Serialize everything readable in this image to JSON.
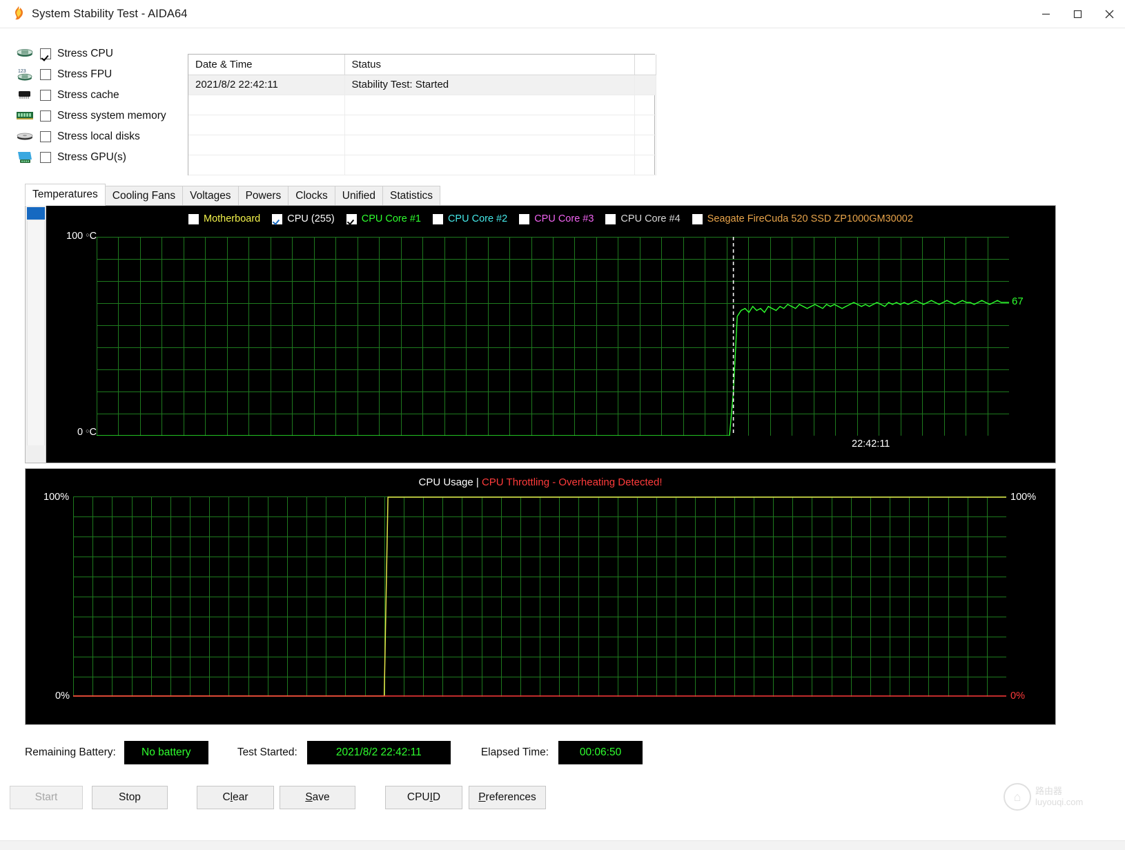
{
  "window": {
    "title": "System Stability Test - AIDA64",
    "icon": "flame-icon",
    "minimize": "−",
    "maximize": "□",
    "close": "✕"
  },
  "stress_options": [
    {
      "label": "Stress CPU",
      "checked": true,
      "icon": "cpu-chip-icon"
    },
    {
      "label": "Stress FPU",
      "checked": false,
      "icon": "fpu-chip-icon"
    },
    {
      "label": "Stress cache",
      "checked": false,
      "icon": "cache-chip-icon"
    },
    {
      "label": "Stress system memory",
      "checked": false,
      "icon": "memory-module-icon"
    },
    {
      "label": "Stress local disks",
      "checked": false,
      "icon": "hard-disk-icon"
    },
    {
      "label": "Stress GPU(s)",
      "checked": false,
      "icon": "gpu-display-icon"
    }
  ],
  "log": {
    "columns": [
      "Date & Time",
      "Status"
    ],
    "rows": [
      {
        "datetime": "2021/8/2 22:42:11",
        "status": "Stability Test: Started"
      },
      {
        "datetime": "",
        "status": ""
      },
      {
        "datetime": "",
        "status": ""
      },
      {
        "datetime": "",
        "status": ""
      },
      {
        "datetime": "",
        "status": ""
      }
    ]
  },
  "tabs": [
    {
      "label": "Temperatures",
      "active": true
    },
    {
      "label": "Cooling Fans",
      "active": false
    },
    {
      "label": "Voltages",
      "active": false
    },
    {
      "label": "Powers",
      "active": false
    },
    {
      "label": "Clocks",
      "active": false
    },
    {
      "label": "Unified",
      "active": false
    },
    {
      "label": "Statistics",
      "active": false
    }
  ],
  "temperature_chart": {
    "legend": [
      {
        "label": "Motherboard",
        "color": "#f2f24a",
        "checked": false
      },
      {
        "label": "CPU (255)",
        "color": "#ffffff",
        "checked": true
      },
      {
        "label": "CPU Core #1",
        "color": "#2eff2e",
        "checked": true
      },
      {
        "label": "CPU Core #2",
        "color": "#45e8e8",
        "checked": false
      },
      {
        "label": "CPU Core #3",
        "color": "#f062f0",
        "checked": false
      },
      {
        "label": "CPU Core #4",
        "color": "#d9d9d9",
        "checked": false
      },
      {
        "label": "Seagate FireCuda 520 SSD ZP1000GM30002",
        "color": "#e8a44a",
        "checked": false
      }
    ],
    "y_top_label": "100",
    "y_top_unit": "C",
    "y_bottom_label": "0",
    "y_bottom_unit": "C",
    "current_value": "67",
    "cursor_timestamp": "22:42:11",
    "grid_color": "#1e7a1e",
    "trace_color": "#2eff2e"
  },
  "usage_chart": {
    "title": "CPU Usage",
    "separator": "|",
    "warning": "CPU Throttling - Overheating Detected!",
    "warning_color": "#ff3b3b",
    "y_top_left": "100%",
    "y_bottom_left": "0%",
    "y_top_right": "100%",
    "y_bottom_right": "0%",
    "usage_trace_color": "#e8e84a",
    "throttle_trace_color": "#ff3b3b",
    "grid_color": "#1e7a1e"
  },
  "status": {
    "battery_label": "Remaining Battery:",
    "battery_value": "No battery",
    "started_label": "Test Started:",
    "started_value": "2021/8/2 22:42:11",
    "elapsed_label": "Elapsed Time:",
    "elapsed_value": "00:06:50"
  },
  "buttons": [
    {
      "label": "Start",
      "disabled": true,
      "accel": ""
    },
    {
      "label": "Stop",
      "disabled": false,
      "accel": ""
    },
    {
      "label": "Clear",
      "disabled": false,
      "accel": "l"
    },
    {
      "label": "Save",
      "disabled": false,
      "accel": "S"
    },
    {
      "label": "CPUID",
      "disabled": false,
      "accel": "I"
    },
    {
      "label": "Preferences",
      "disabled": false,
      "accel": "P"
    }
  ],
  "watermark": {
    "line1": "路由器",
    "line2": "luyouqi.com"
  },
  "chart_data": [
    {
      "type": "line",
      "title": "Temperatures",
      "xlabel": "",
      "ylabel": "C",
      "ylim": [
        0,
        100
      ],
      "grid": true,
      "legend_position": "top",
      "x_tick_labels": [
        "22:42:11"
      ],
      "series": [
        {
          "name": "CPU Core #1",
          "color": "#2eff2e",
          "current": 67,
          "values": [
            0,
            0,
            0,
            0,
            0,
            0,
            0,
            0,
            0,
            0,
            0,
            0,
            0,
            0,
            0,
            0,
            0,
            0,
            0,
            0,
            0,
            0,
            0,
            0,
            0,
            0,
            0,
            0,
            0,
            0,
            0,
            0,
            0,
            0,
            0,
            0,
            0,
            0,
            0,
            0,
            0,
            0,
            0,
            0,
            0,
            0,
            0,
            0,
            0,
            0,
            0,
            0,
            0,
            0,
            0,
            0,
            0,
            0,
            0,
            0,
            0,
            0,
            0,
            0,
            0,
            0,
            0,
            0,
            0,
            0,
            0,
            0,
            0,
            0,
            0,
            0,
            0,
            0,
            0,
            0,
            0,
            0,
            0,
            0,
            0,
            0,
            0,
            0,
            0,
            0,
            0,
            0,
            0,
            0,
            0,
            0,
            0,
            0,
            0,
            0,
            0,
            0,
            0,
            0,
            0,
            0,
            0,
            0,
            0,
            0,
            0,
            0,
            0,
            0,
            0,
            0,
            0,
            0,
            0,
            0,
            0,
            0,
            0,
            0,
            0,
            0,
            0,
            0,
            0,
            0,
            0,
            0,
            0,
            0,
            0,
            0,
            0,
            0,
            0,
            0,
            0,
            0,
            0,
            0,
            0,
            0,
            0,
            0,
            0,
            0,
            0,
            0,
            0,
            0,
            0,
            0,
            0,
            0,
            0,
            0,
            0,
            0,
            0,
            0,
            22,
            60,
            63,
            64,
            62,
            65,
            63,
            64,
            62,
            65,
            64,
            63,
            65,
            64,
            66,
            65,
            64,
            66,
            65,
            64,
            65,
            66,
            65,
            64,
            66,
            65,
            66,
            65,
            64,
            65,
            66,
            67,
            66,
            65,
            66,
            65,
            66,
            67,
            66,
            65,
            67,
            66,
            67,
            66,
            67,
            66,
            67,
            68,
            67,
            66,
            67,
            68,
            67,
            66,
            67,
            68,
            67,
            66,
            67,
            68,
            67,
            67,
            66,
            67,
            68,
            67,
            66,
            67,
            68,
            67,
            67,
            67
          ]
        }
      ]
    },
    {
      "type": "line",
      "title": "CPU Usage",
      "xlabel": "",
      "ylabel": "%",
      "ylim": [
        0,
        100
      ],
      "grid": true,
      "series": [
        {
          "name": "CPU Usage",
          "color": "#e8e84a",
          "values": [
            0,
            0,
            0,
            0,
            0,
            0,
            0,
            0,
            0,
            0,
            0,
            0,
            0,
            0,
            0,
            0,
            0,
            0,
            0,
            0,
            0,
            0,
            0,
            0,
            0,
            0,
            0,
            0,
            0,
            0,
            0,
            0,
            0,
            0,
            0,
            0,
            0,
            0,
            0,
            0,
            0,
            0,
            0,
            0,
            0,
            0,
            0,
            0,
            0,
            0,
            0,
            0,
            0,
            0,
            0,
            0,
            0,
            0,
            0,
            0,
            0,
            0,
            0,
            0,
            0,
            0,
            0,
            0,
            0,
            0,
            0,
            0,
            0,
            0,
            0,
            0,
            0,
            0,
            0,
            0,
            0,
            0,
            0,
            0,
            100,
            100,
            100,
            100,
            100,
            100,
            100,
            100,
            100,
            100,
            100,
            100,
            100,
            100,
            100,
            100,
            100,
            100,
            100,
            100,
            100,
            100,
            100,
            100,
            100,
            100,
            100,
            100,
            100,
            100,
            100,
            100,
            100,
            100,
            100,
            100,
            100,
            100,
            100,
            100,
            100,
            100,
            100,
            100,
            100,
            100,
            100,
            100,
            100,
            100,
            100,
            100,
            100,
            100,
            100,
            100,
            100,
            100,
            100,
            100,
            100,
            100,
            100,
            100,
            100,
            100,
            100,
            100,
            100,
            100,
            100,
            100,
            100,
            100,
            100,
            100,
            100,
            100,
            100,
            100,
            100,
            100,
            100,
            100,
            100,
            100,
            100,
            100,
            100,
            100,
            100,
            100,
            100,
            100,
            100,
            100,
            100,
            100,
            100,
            100,
            100,
            100,
            100,
            100,
            100,
            100,
            100,
            100,
            100,
            100,
            100,
            100,
            100,
            100,
            100,
            100,
            100,
            100,
            100,
            100,
            100,
            100,
            100,
            100,
            100,
            100,
            100,
            100,
            100,
            100,
            100,
            100,
            100,
            100,
            100,
            100,
            100,
            100,
            100,
            100,
            100,
            100,
            100,
            100,
            100,
            100,
            100,
            100,
            100,
            100,
            100,
            100,
            100,
            100,
            100,
            100,
            100,
            100,
            100,
            100,
            100,
            100,
            100,
            100,
            100,
            100
          ]
        },
        {
          "name": "CPU Throttling",
          "color": "#ff3b3b",
          "values": [
            0,
            0,
            0,
            0,
            0,
            0,
            0,
            0,
            0,
            0,
            0,
            0,
            0,
            0,
            0,
            0,
            0,
            0,
            0,
            0,
            0,
            0,
            0,
            0,
            0,
            0,
            0,
            0,
            0,
            0,
            0,
            0,
            0,
            0,
            0,
            0,
            0,
            0,
            0,
            0,
            0,
            0,
            0,
            0,
            0,
            0,
            0,
            0,
            0,
            0,
            0,
            0,
            0,
            0,
            0,
            0,
            0,
            0,
            0,
            0,
            0,
            0,
            0,
            0,
            0,
            0,
            0,
            0,
            0,
            0,
            0,
            0,
            0,
            0,
            0,
            0,
            0,
            0,
            0,
            0,
            0,
            0,
            0,
            0,
            0,
            0,
            0,
            0,
            0,
            0,
            0,
            0,
            0,
            0,
            0,
            0,
            0,
            0,
            0,
            0,
            0,
            0,
            0,
            0,
            0,
            0,
            0,
            0,
            0,
            0,
            0,
            0,
            0,
            0,
            0,
            0,
            0,
            0,
            0,
            0,
            0,
            0,
            0,
            0,
            0,
            0,
            0,
            0,
            0,
            0,
            0,
            0,
            0,
            0,
            0,
            0,
            0,
            0,
            0,
            0,
            0,
            0,
            0,
            0,
            0,
            0,
            0,
            0,
            0,
            0,
            0,
            0,
            0,
            0,
            0,
            0,
            0,
            0,
            0,
            0,
            0,
            0,
            0,
            0,
            0,
            0,
            0,
            0,
            0,
            0,
            0,
            0,
            0,
            0,
            0,
            0,
            0,
            0,
            0,
            0,
            0,
            0,
            0,
            0,
            0,
            0,
            0,
            0,
            0,
            0,
            0,
            0,
            0,
            0,
            0,
            0,
            0,
            0,
            0,
            0,
            0,
            0,
            0,
            0,
            0,
            0,
            0,
            0,
            0,
            0,
            0,
            0,
            0,
            0,
            0,
            0,
            0,
            0,
            0,
            0,
            0,
            0,
            0,
            0,
            0,
            0
          ]
        }
      ]
    }
  ]
}
